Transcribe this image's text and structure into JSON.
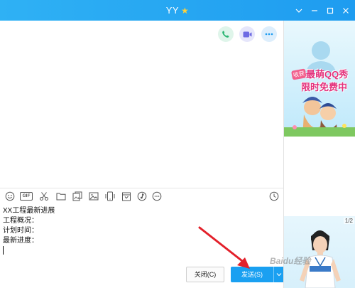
{
  "window": {
    "title": "YY",
    "title_icon": "star-icon",
    "controls": [
      "chevron-down-icon",
      "minimize-icon",
      "maximize-icon",
      "close-icon"
    ],
    "accent_color": "#1e9cf0"
  },
  "chat_actions": [
    {
      "icon": "phone-icon",
      "color": "#2bb673"
    },
    {
      "icon": "video-camera-icon",
      "color": "#6e6be3"
    },
    {
      "icon": "more-icon",
      "color": "#1e9cf0"
    }
  ],
  "toolbar": {
    "left_icons": [
      "emoji-icon",
      "gif-icon",
      "scissors-icon",
      "folder-icon",
      "picture-folder-icon",
      "image-icon",
      "screen-share-icon",
      "calendar-icon",
      "music-note-icon",
      "more-icon"
    ],
    "gif_label": "GIF",
    "right_icon": "history-clock-icon"
  },
  "message_input": {
    "lines": [
      "XX工程最新进展",
      "工程概况：",
      "计划时间：",
      "最新进度："
    ]
  },
  "buttons": {
    "close_label": "关闭(C)",
    "send_label": "发送(S)"
  },
  "right_panel": {
    "ad_badge": "收获",
    "ad_line1": "最萌QQ秀",
    "ad_line2": "限时免费中",
    "page_indicator": "1/2"
  },
  "watermark": "Baidu经验"
}
